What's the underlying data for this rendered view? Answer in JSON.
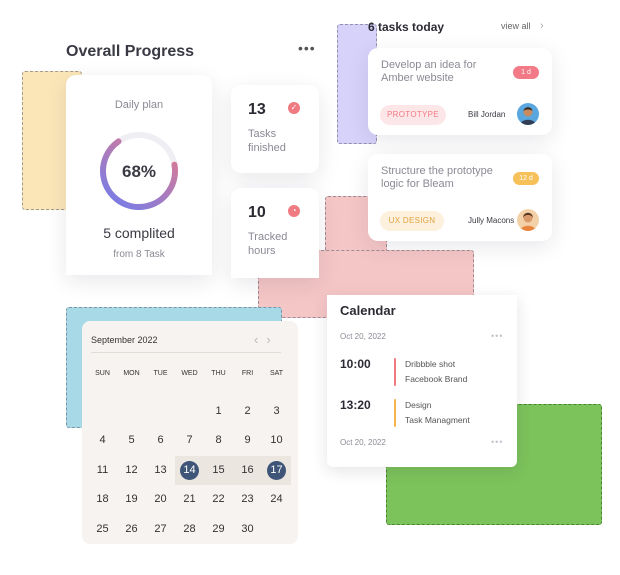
{
  "overall": {
    "title": "Overall Progress",
    "more": "•••",
    "plan_label": "Daily plan",
    "percent": "68%",
    "percent_value": 0.68,
    "completed": "5 complited",
    "from": "from 8 Task"
  },
  "stats": [
    {
      "value": "13",
      "label": "Tasks finished",
      "icon": "check-icon"
    },
    {
      "value": "10",
      "label": "Tracked hours",
      "icon": "clock-icon"
    }
  ],
  "tasks": {
    "title": "6 tasks today",
    "view_all": "view all",
    "items": [
      {
        "title": "Develop an idea for Amber website",
        "badge": "1 d",
        "badge_color": "#f27a86",
        "tag": "PROTOTYPE",
        "tag_bg": "#fde6e8",
        "tag_color": "#f27a86",
        "assignee": "Bill Jordan",
        "avatar_color": "#5aa7e0"
      },
      {
        "title": "Structure the prototype logic for Bleam",
        "badge": "12 d",
        "badge_color": "#f7c15a",
        "tag": "UX DESIGN",
        "tag_bg": "#fdf0dc",
        "tag_color": "#e0a340",
        "assignee": "Jully Macons",
        "avatar_color": "#e89a5b"
      }
    ]
  },
  "calendar": {
    "title": "Calendar",
    "date1": "Oct 20, 2022",
    "date2": "Oct 20, 2022",
    "more": "•••",
    "events": [
      {
        "time": "10:00",
        "line1": "Dribbble shot",
        "line2": "Facebook Brand",
        "color": "#f07a82"
      },
      {
        "time": "13:20",
        "line1": "Design",
        "line2": "Task Managment",
        "color": "#f5b54a"
      }
    ]
  },
  "month": {
    "title": "September 2022",
    "prev": "‹",
    "next": "›",
    "weekdays": [
      "SUN",
      "MON",
      "TUE",
      "WED",
      "THU",
      "FRI",
      "SAT"
    ],
    "days": [
      "",
      "",
      "",
      "",
      "1",
      "2",
      "3",
      "4",
      "5",
      "6",
      "7",
      "8",
      "9",
      "10",
      "11",
      "12",
      "13",
      "14",
      "15",
      "16",
      "17",
      "18",
      "19",
      "20",
      "21",
      "22",
      "23",
      "24",
      "25",
      "26",
      "27",
      "28",
      "29",
      "30",
      ""
    ],
    "range_start": "14",
    "range_end": "17"
  },
  "colors": {
    "ring_start": "#f07a82",
    "ring_end": "#6d7cf0",
    "ring_track": "#eeeef3",
    "deco_yellow": "#fbe6b8",
    "deco_purple": "#d7d2fa",
    "deco_pink": "#f5c6c6",
    "deco_blue": "#a7dae6",
    "deco_green": "#7cc35b"
  }
}
